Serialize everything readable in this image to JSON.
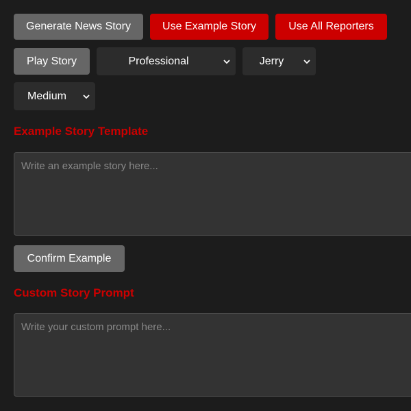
{
  "toolbar": {
    "generate_label": "Generate News Story",
    "use_example_label": "Use Example Story",
    "use_all_reporters_label": "Use All Reporters",
    "play_label": "Play Story"
  },
  "selects": {
    "style": {
      "selected": "Professional"
    },
    "reporter": {
      "selected": "Jerry"
    },
    "length": {
      "selected": "Medium"
    }
  },
  "example_section": {
    "heading": "Example Story Template",
    "placeholder": "Write an example story here...",
    "value": "",
    "confirm_label": "Confirm Example"
  },
  "custom_section": {
    "heading": "Custom Story Prompt",
    "placeholder": "Write your custom prompt here...",
    "value": ""
  },
  "colors": {
    "background": "#1c1c1c",
    "accent_red": "#cc0000",
    "button_gray": "#666666",
    "select_bg": "#2c2c2c",
    "textarea_bg": "#333333"
  },
  "icons": {
    "select_arrow": "chevron-down-icon"
  }
}
